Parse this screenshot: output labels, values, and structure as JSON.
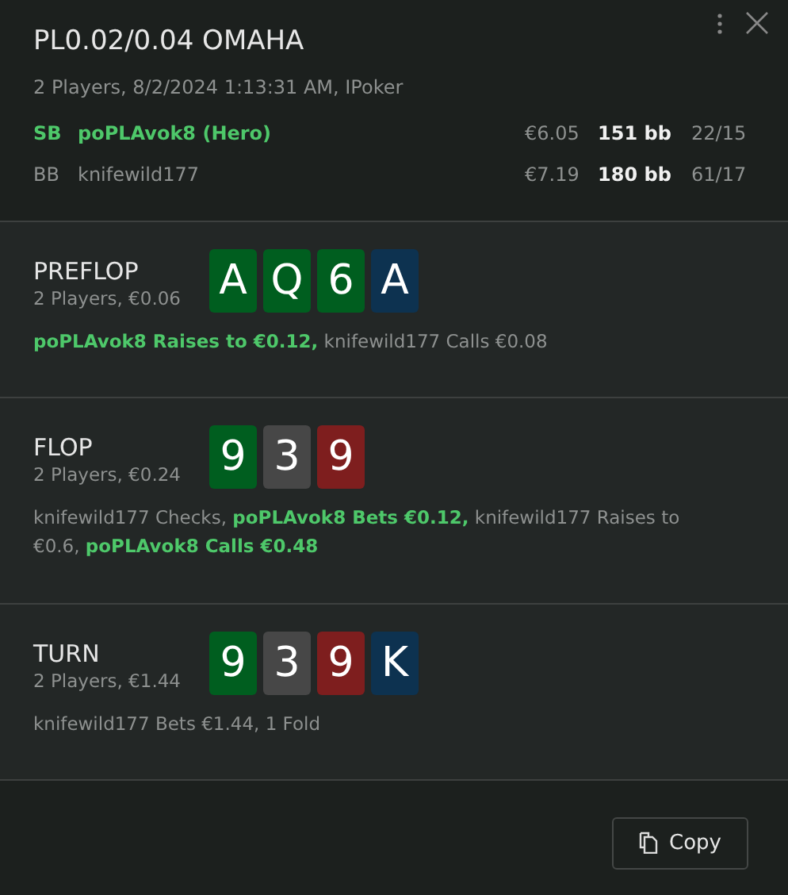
{
  "header": {
    "title": "PL0.02/0.04 OMAHA",
    "subtitle": "2 Players, 8/2/2024 1:13:31 AM, IPoker"
  },
  "players": [
    {
      "position": "SB",
      "name": "poPLAvok8 (Hero)",
      "hero": true,
      "stack": "€6.05",
      "bb": "151 bb",
      "stats": "22/15"
    },
    {
      "position": "BB",
      "name": "knifewild177",
      "hero": false,
      "stack": "€7.19",
      "bb": "180 bb",
      "stats": "61/17"
    }
  ],
  "streets": [
    {
      "name": "PREFLOP",
      "info": "2 Players, €0.06",
      "cards": [
        {
          "rank": "A",
          "color": "#005e1f"
        },
        {
          "rank": "Q",
          "color": "#005e1f"
        },
        {
          "rank": "6",
          "color": "#005e1f"
        },
        {
          "rank": "A",
          "color": "#0d3250"
        }
      ],
      "actions": [
        {
          "text": "poPLAvok8 Raises to €0.12,",
          "hero": true
        },
        {
          "text": "knifewild177 Calls €0.08",
          "hero": false
        }
      ]
    },
    {
      "name": "FLOP",
      "info": "2 Players, €0.24",
      "cards": [
        {
          "rank": "9",
          "color": "#005e1f"
        },
        {
          "rank": "3",
          "color": "#474747"
        },
        {
          "rank": "9",
          "color": "#7e1e1e"
        }
      ],
      "actions": [
        {
          "text": "knifewild177 Checks,",
          "hero": false
        },
        {
          "text": "poPLAvok8 Bets €0.12,",
          "hero": true
        },
        {
          "text": "knifewild177 Raises to €0.6,",
          "hero": false
        },
        {
          "text": "poPLAvok8 Calls €0.48",
          "hero": true
        }
      ]
    },
    {
      "name": "TURN",
      "info": "2 Players, €1.44",
      "cards": [
        {
          "rank": "9",
          "color": "#005e1f"
        },
        {
          "rank": "3",
          "color": "#474747"
        },
        {
          "rank": "9",
          "color": "#7e1e1e"
        },
        {
          "rank": "K",
          "color": "#0d3250"
        }
      ],
      "actions": [
        {
          "text": "knifewild177 Bets €1.44, 1 Fold",
          "hero": false
        }
      ]
    }
  ],
  "copy_button": "Copy"
}
